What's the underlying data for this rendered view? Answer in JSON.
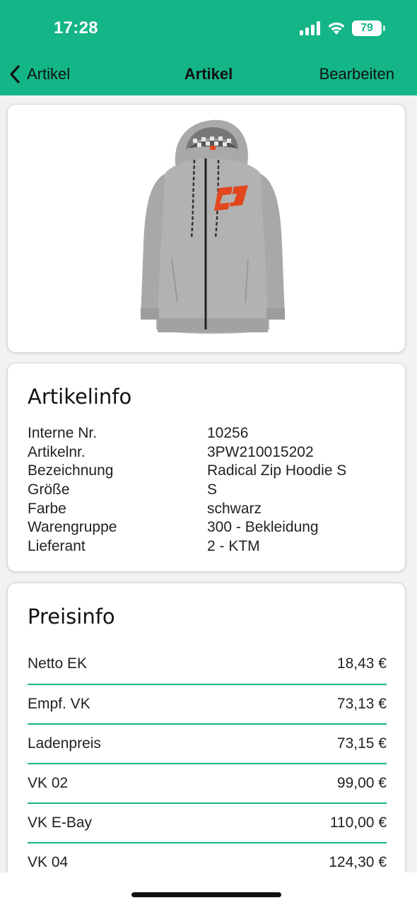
{
  "status_bar": {
    "time": "17:28",
    "battery": "79",
    "icons": [
      "signal-icon",
      "wifi-icon",
      "battery-icon"
    ]
  },
  "nav": {
    "back_label": "Artikel",
    "title": "Artikel",
    "edit_label": "Bearbeiten"
  },
  "artikelinfo": {
    "title": "Artikelinfo",
    "rows": [
      {
        "label": "Interne Nr.",
        "value": "10256"
      },
      {
        "label": "Artikelnr.",
        "value": "3PW210015202"
      },
      {
        "label": "Bezeichnung",
        "value": "Radical Zip Hoodie S"
      },
      {
        "label": "Größe",
        "value": "S"
      },
      {
        "label": "Farbe",
        "value": "schwarz"
      },
      {
        "label": "Warengruppe",
        "value": "300 - Bekleidung"
      },
      {
        "label": "Lieferant",
        "value": "2 - KTM"
      }
    ]
  },
  "preisinfo": {
    "title": "Preisinfo",
    "rows": [
      {
        "label": "Netto EK",
        "value": "18,43 €"
      },
      {
        "label": "Empf. VK",
        "value": "73,13 €"
      },
      {
        "label": "Ladenpreis",
        "value": "73,15 €"
      },
      {
        "label": "VK 02",
        "value": "99,00 €"
      },
      {
        "label": "VK E-Bay",
        "value": "110,00 €"
      },
      {
        "label": "VK 04",
        "value": "124,30 €"
      }
    ]
  },
  "colors": {
    "accent": "#14b587",
    "background": "#f2f2f2",
    "card": "#ffffff"
  }
}
